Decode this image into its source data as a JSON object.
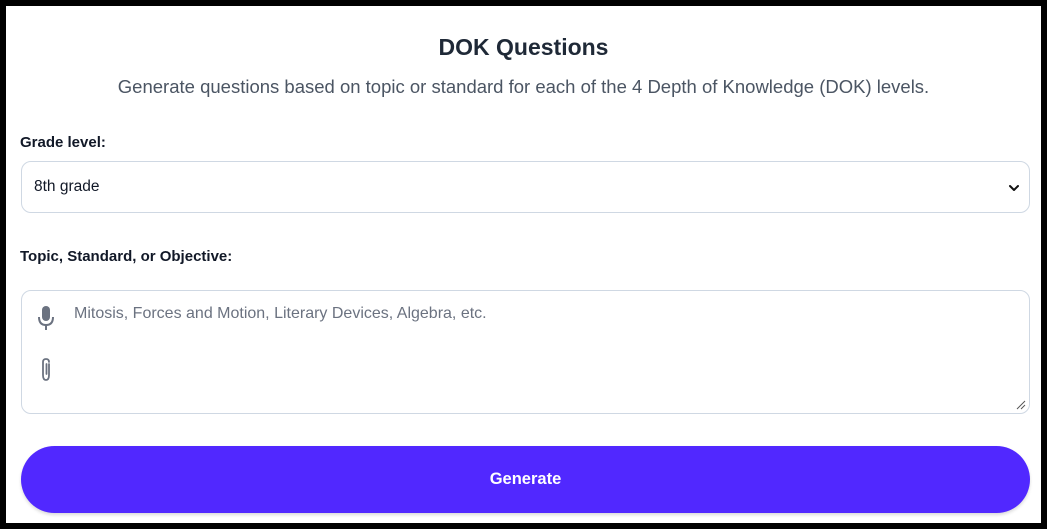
{
  "header": {
    "title": "DOK Questions",
    "subtitle": "Generate questions based on topic or standard for each of the 4 Depth of Knowledge (DOK) levels."
  },
  "grade_level": {
    "label": "Grade level:",
    "selected": "8th grade",
    "chevron_icon": "chevron-down-icon"
  },
  "topic": {
    "label": "Topic, Standard, or Objective:",
    "placeholder": "Mitosis, Forces and Motion, Literary Devices, Algebra, etc.",
    "value": "",
    "icons": [
      "microphone-icon",
      "paperclip-icon"
    ]
  },
  "generate_button": {
    "label": "Generate",
    "color": "#5128ff"
  }
}
